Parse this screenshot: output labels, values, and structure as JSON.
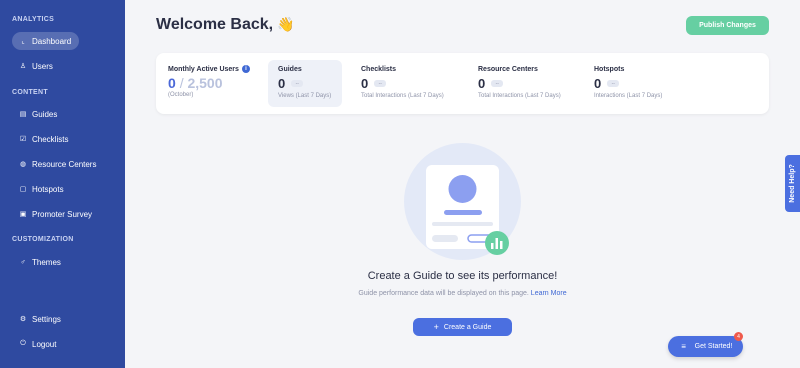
{
  "sidebar": {
    "sections": [
      {
        "title": "ANALYTICS"
      },
      {
        "title": "CONTENT"
      },
      {
        "title": "CUSTOMIZATION"
      }
    ],
    "items": [
      {
        "label": "Dashboard",
        "icon": "chart-icon"
      },
      {
        "label": "Users",
        "icon": "user-icon"
      },
      {
        "label": "Guides",
        "icon": "guide-icon"
      },
      {
        "label": "Checklists",
        "icon": "checklist-icon"
      },
      {
        "label": "Resource Centers",
        "icon": "globe-icon"
      },
      {
        "label": "Hotspots",
        "icon": "hotspot-icon"
      },
      {
        "label": "Promoter Survey",
        "icon": "survey-icon"
      },
      {
        "label": "Themes",
        "icon": "theme-icon"
      },
      {
        "label": "Settings",
        "icon": "gear-icon"
      },
      {
        "label": "Logout",
        "icon": "logout-icon"
      }
    ]
  },
  "header": {
    "title": "Welcome Back,",
    "emoji": "👋",
    "publish_label": "Publish Changes"
  },
  "stats": {
    "mau": {
      "label": "Monthly Active Users",
      "value": "0",
      "separator": "/",
      "total": "2,500",
      "sub": "(October)"
    },
    "items": [
      {
        "label": "Guides",
        "value": "0",
        "delta": "--",
        "sub": "Views (Last 7 Days)"
      },
      {
        "label": "Checklists",
        "value": "0",
        "delta": "--",
        "sub": "Total Interactions (Last 7 Days)"
      },
      {
        "label": "Resource Centers",
        "value": "0",
        "delta": "--",
        "sub": "Total Interactions (Last 7 Days)"
      },
      {
        "label": "Hotspots",
        "value": "0",
        "delta": "--",
        "sub": "Interactions (Last 7 Days)"
      }
    ]
  },
  "empty_state": {
    "title": "Create a Guide to see its performance!",
    "description": "Guide performance data will be displayed on this page.",
    "link": "Learn More",
    "button": "Create a Guide"
  },
  "help_tab": "Need Help?",
  "get_started": {
    "label": "Get Started!",
    "badge": "4"
  },
  "colors": {
    "sidebar": "#2f4aa0",
    "accent": "#4b6fe0",
    "publish": "#66cfa2",
    "badge": "#ef5a4c"
  }
}
